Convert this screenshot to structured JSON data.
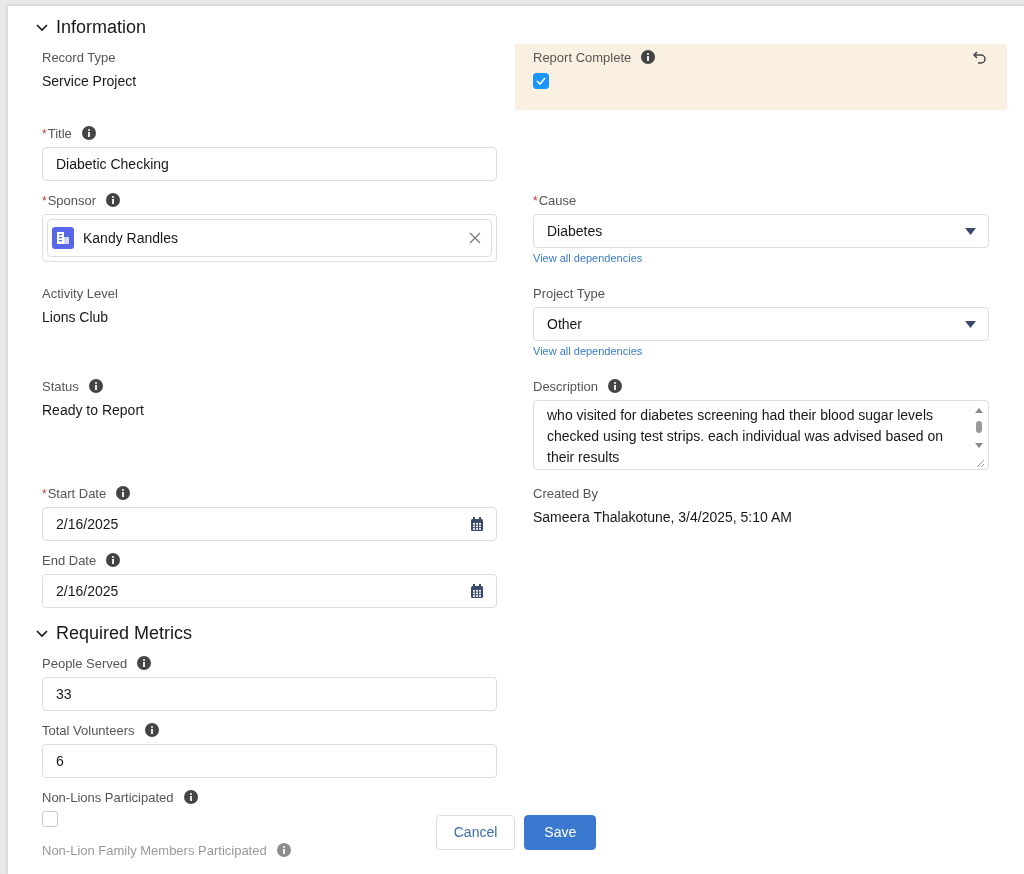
{
  "sections": [
    {
      "title": "Information",
      "expanded": true,
      "rows": [
        {
          "left": {
            "kind": "readonly",
            "label": "Record Type",
            "value": "Service Project",
            "info": false
          },
          "right": {
            "kind": "checkbox",
            "label": "Report Complete",
            "checked": true,
            "info": true,
            "highlighted": true
          }
        },
        {
          "left": {
            "kind": "text",
            "label": "Title",
            "value": "Diabetic Checking",
            "required_mark": "*",
            "info": true
          },
          "right": null
        },
        {
          "left": {
            "kind": "lookup",
            "label": "Sponsor",
            "value": "Kandy Randles",
            "required_mark": "*",
            "info": true
          },
          "right": {
            "kind": "picklist",
            "label": "Cause",
            "value": "Diabetes",
            "required_mark": "*",
            "info": false,
            "link": "View all dependencies"
          }
        },
        {
          "left": {
            "kind": "readonly",
            "label": "Activity Level",
            "value": "Lions Club",
            "info": false
          },
          "right": {
            "kind": "picklist",
            "label": "Project Type",
            "value": "Other",
            "info": false,
            "link": "View all dependencies"
          }
        },
        {
          "left": {
            "kind": "readonly",
            "label": "Status",
            "value": "Ready to Report",
            "info": true
          },
          "right": {
            "kind": "textarea",
            "label": "Description",
            "value": "who visited for diabetes screening had their blood sugar levels checked using test strips. each individual was advised based on their results",
            "info": true
          }
        },
        {
          "left": {
            "kind": "date",
            "label": "Start Date",
            "value": "2/16/2025",
            "required_mark": "*",
            "info": true
          },
          "right": {
            "kind": "readonly",
            "label": "Created By",
            "value": "Sameera Thalakotune, 3/4/2025, 5:10 AM",
            "info": false
          }
        },
        {
          "left": {
            "kind": "date",
            "label": "End Date",
            "value": "2/16/2025",
            "info": true
          },
          "right": null
        }
      ]
    },
    {
      "title": "Required Metrics",
      "expanded": true,
      "rows": [
        {
          "left": {
            "kind": "text",
            "label": "People Served",
            "value": "33",
            "info": true
          },
          "right": null
        },
        {
          "left": {
            "kind": "text",
            "label": "Total Volunteers",
            "value": "6",
            "info": true
          },
          "right": null
        },
        {
          "left": {
            "kind": "checkbox",
            "label": "Non-Lions Participated",
            "checked": false,
            "info": true
          },
          "right": null
        },
        {
          "left": {
            "kind": "label",
            "label": "Non-Lion Family Members Participated",
            "info": true,
            "faded": true
          },
          "right": null
        }
      ]
    }
  ],
  "footer": {
    "buttons": [
      {
        "label": "Cancel",
        "kind": "neutral"
      },
      {
        "label": "Save",
        "kind": "brand"
      }
    ]
  }
}
